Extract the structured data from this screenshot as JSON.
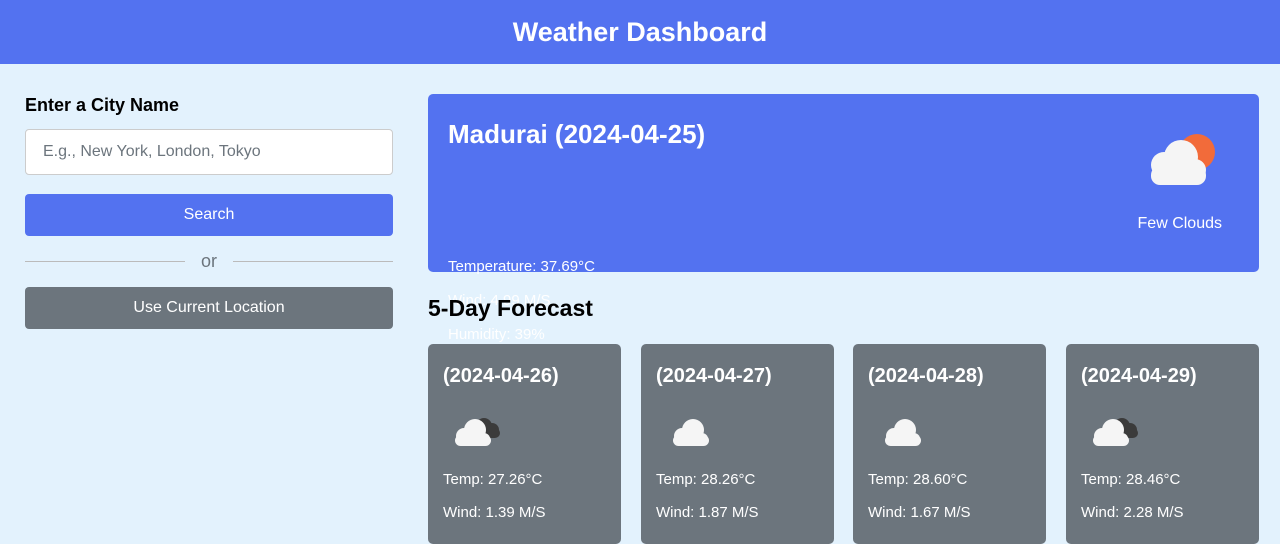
{
  "header": {
    "title": "Weather Dashboard"
  },
  "search": {
    "label": "Enter a City Name",
    "placeholder": "E.g., New York, London, Tokyo",
    "search_button": "Search",
    "separator_text": "or",
    "location_button": "Use Current Location"
  },
  "current": {
    "title": "Madurai (2024-04-25)",
    "temperature": "Temperature: 37.69°C",
    "wind": "Wind: 4.99 M/S",
    "humidity": "Humidity: 39%",
    "description": "Few Clouds",
    "icon": "few-clouds-day-icon"
  },
  "forecast": {
    "title": "5-Day Forecast",
    "days": [
      {
        "date": "(2024-04-26)",
        "temp": "Temp: 27.26°C",
        "wind": "Wind: 1.39 M/S",
        "icon": "broken-clouds-icon"
      },
      {
        "date": "(2024-04-27)",
        "temp": "Temp: 28.26°C",
        "wind": "Wind: 1.87 M/S",
        "icon": "cloud-icon"
      },
      {
        "date": "(2024-04-28)",
        "temp": "Temp: 28.60°C",
        "wind": "Wind: 1.67 M/S",
        "icon": "cloud-icon"
      },
      {
        "date": "(2024-04-29)",
        "temp": "Temp: 28.46°C",
        "wind": "Wind: 2.28 M/S",
        "icon": "broken-clouds-icon"
      }
    ]
  },
  "colors": {
    "primary": "#5372f0",
    "secondary": "#6c757d",
    "background": "#e3f2fd",
    "sun": "#f26b3a"
  }
}
